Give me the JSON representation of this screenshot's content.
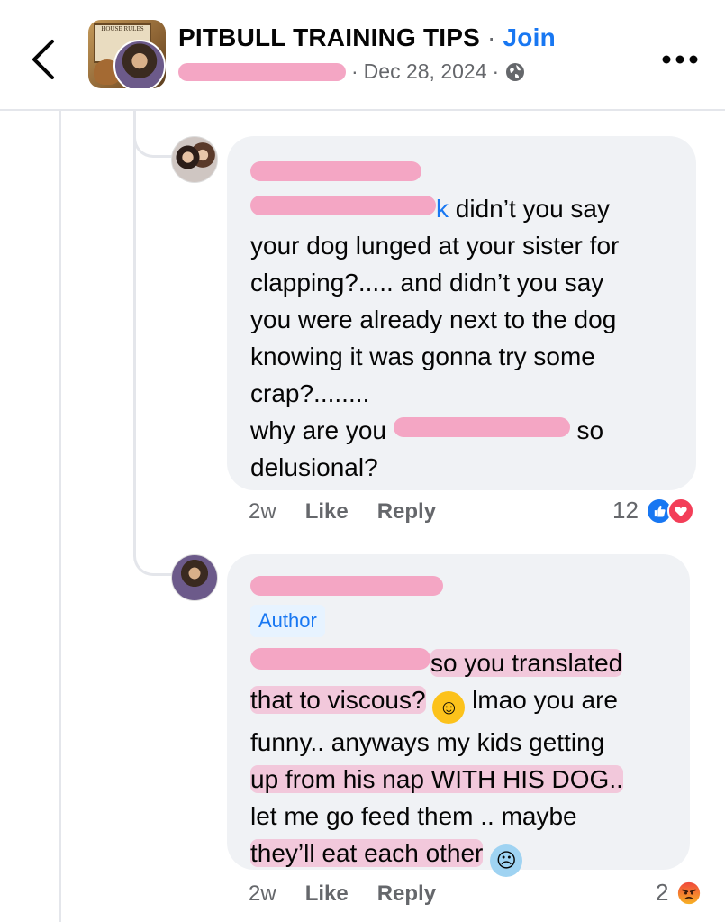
{
  "header": {
    "group_name": "PITBULL TRAINING TIPS",
    "separator": "·",
    "join_label": "Join",
    "post_date": "Dec 28, 2024",
    "avatar_sign_text": "HOUSE RULES"
  },
  "comments": [
    {
      "author_name": "",
      "lines": {
        "l1": "didn’t you say",
        "l2": "your dog lunged at your sister for",
        "l3": "clapping?..... and didn’t you say",
        "l4": "you were already next to the dog",
        "l5": "knowing it was gonna try some",
        "l6": "crap?........",
        "l7a": "why are you",
        "l7b": "so",
        "l8": "delusional?"
      },
      "time": "2w",
      "like_label": "Like",
      "reply_label": "Reply",
      "reaction_count": "12",
      "reactions": [
        "like",
        "love"
      ]
    },
    {
      "author_badge": "Author",
      "lines": {
        "l1": "so you translated",
        "l2": "that to viscous?",
        "l2b": "lmao you are",
        "l3": "funny.. anyways my kids getting",
        "l4": "up from his nap WITH HIS DOG..",
        "l5": "let me go feed them .. maybe",
        "l6": "they’ll eat each other"
      },
      "time": "2w",
      "like_label": "Like",
      "reply_label": "Reply",
      "reaction_count": "2",
      "reactions": [
        "angry"
      ]
    }
  ],
  "colors": {
    "accent": "#1877f2",
    "meta_gray": "#65676b",
    "bubble_bg": "#f0f2f5",
    "redaction_pink": "#f4a6c4"
  }
}
